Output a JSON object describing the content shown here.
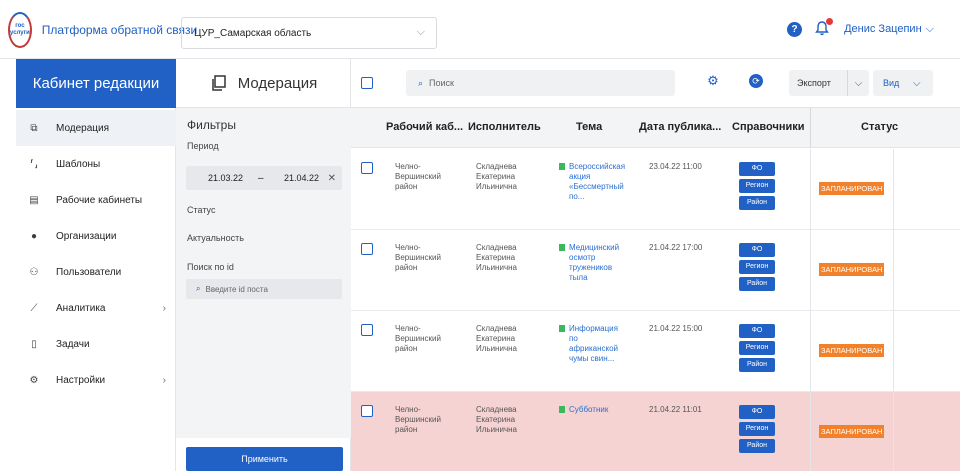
{
  "header": {
    "logo_line1": "гос",
    "logo_line2": "услуги",
    "app_title": "Платформа обратной связи",
    "region": "ЦУР_Самарская область",
    "help": "?",
    "user_name": "Денис Зацепин"
  },
  "sidebar": {
    "title": "Кабинет редакции",
    "items": [
      {
        "label": "Модерация",
        "icon": "copy-icon",
        "active": true
      },
      {
        "label": "Шаблоны",
        "icon": "brackets-icon"
      },
      {
        "label": "Рабочие кабинеты",
        "icon": "cabinet-icon"
      },
      {
        "label": "Организации",
        "icon": "location-pin-icon"
      },
      {
        "label": "Пользователи",
        "icon": "users-icon"
      },
      {
        "label": "Аналитика",
        "icon": "chart-icon",
        "has_submenu": true
      },
      {
        "label": "Задачи",
        "icon": "document-icon"
      },
      {
        "label": "Настройки",
        "icon": "gear-icon",
        "has_submenu": true
      }
    ]
  },
  "filters": {
    "section_title": "Модерация",
    "heading": "Фильтры",
    "period_label": "Период",
    "date_from": "21.03.22",
    "date_sep": "–",
    "date_to": "21.04.22",
    "clear": "✕",
    "status_label": "Статус",
    "relevance_label": "Актуальность",
    "id_label": "Поиск по id",
    "id_placeholder": "Введите id поста",
    "apply_label": "Применить"
  },
  "toolbar": {
    "search_placeholder": "Поиск",
    "export_label": "Экспорт",
    "view_label": "Вид"
  },
  "table": {
    "columns": [
      "Рабочий каб...",
      "Исполнитель",
      "Тема",
      "Дата публика...",
      "Справочники",
      "Статус"
    ],
    "tags": [
      "ФО",
      "Регион",
      "Район"
    ],
    "rows": [
      {
        "cabinet": [
          "Челно-",
          "Вершинский",
          "район"
        ],
        "executor": [
          "Складнева",
          "Екатерина",
          "Ильинична"
        ],
        "topic": [
          "Всероссийская",
          "акция",
          "«Бессмертный",
          "по..."
        ],
        "date": "23.04.22 11:00",
        "status": "ЗАПЛАНИРОВАН",
        "highlight": false
      },
      {
        "cabinet": [
          "Челно-",
          "Вершинский",
          "район"
        ],
        "executor": [
          "Складнева",
          "Екатерина",
          "Ильинична"
        ],
        "topic": [
          "Медицинский",
          "осмотр",
          "тружеников",
          "тыла"
        ],
        "date": "21.04.22 17:00",
        "status": "ЗАПЛАНИРОВАН",
        "highlight": false
      },
      {
        "cabinet": [
          "Челно-",
          "Вершинский",
          "район"
        ],
        "executor": [
          "Складнева",
          "Екатерина",
          "Ильинична"
        ],
        "topic": [
          "Информация",
          "по",
          "африканской",
          "чумы свин..."
        ],
        "date": "21.04.22 15:00",
        "status": "ЗАПЛАНИРОВАН",
        "highlight": false
      },
      {
        "cabinet": [
          "Челно-",
          "Вершинский",
          "район"
        ],
        "executor": [
          "Складнева",
          "Екатерина",
          "Ильинична"
        ],
        "topic": [
          "Субботник"
        ],
        "date": "21.04.22 11:01",
        "status": "ЗАПЛАНИРОВАН",
        "highlight": true
      }
    ]
  },
  "colors": {
    "accent": "#2160c4",
    "status_planned": "#f1822b",
    "topic_marker": "#3bb85c",
    "row_highlight": "#f6d3d3"
  }
}
